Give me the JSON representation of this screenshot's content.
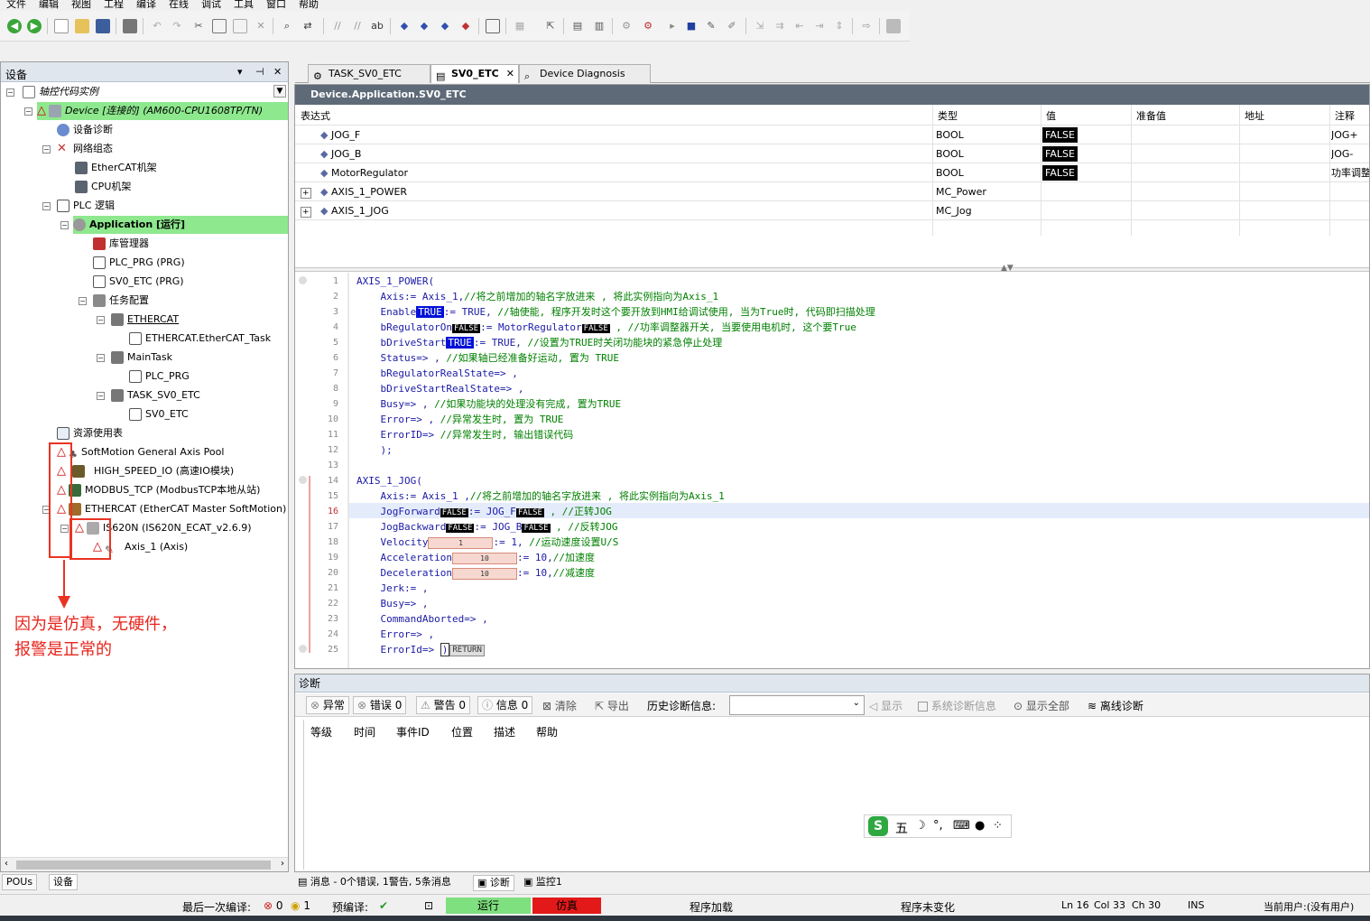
{
  "menu": [
    "文件",
    "编辑",
    "视图",
    "工程",
    "编译",
    "在线",
    "调试",
    "工具",
    "窗口",
    "帮助"
  ],
  "devices_panel": {
    "title": "设备",
    "pin": "⊣",
    "close": "✕",
    "tree": {
      "project": "轴控代码实例",
      "device": "Device [连接的] (AM600-CPU1608TP/TN)",
      "device_diag": "设备诊断",
      "network": "网络组态",
      "ethercat_rack": "EtherCAT机架",
      "cpu_rack": "CPU机架",
      "plc_logic": "PLC 逻辑",
      "application": "Application [运行]",
      "library": "库管理器",
      "plc_prg": "PLC_PRG (PRG)",
      "sv0_etc": "SV0_ETC (PRG)",
      "task_config": "任务配置",
      "ethercat_task": "ETHERCAT",
      "ethercat_task_child": "ETHERCAT.EtherCAT_Task",
      "main_task": "MainTask",
      "main_task_child": "PLC_PRG",
      "task_sv0": "TASK_SV0_ETC",
      "task_sv0_child": "SV0_ETC",
      "resources": "资源使用表",
      "axis_pool": "SoftMotion General Axis Pool",
      "high_speed_io": "HIGH_SPEED_IO (高速IO模块)",
      "modbus_tcp": "MODBUS_TCP (ModbusTCP本地从站)",
      "ethercat_master": "ETHERCAT (EtherCAT Master SoftMotion)",
      "is620n": "IS620N (IS620N_ECAT_v2.6.9)",
      "axis1": "Axis_1 (Axis)"
    },
    "bottom_tabs": [
      "POUs",
      "设备"
    ]
  },
  "annotation": {
    "note": "因为是仿真，无硬件，\n报警是正常的"
  },
  "editor": {
    "tabs": [
      "TASK_SV0_ETC",
      "SV0_ETC",
      "Device Diagnosis"
    ],
    "path": "Device.Application.SV0_ETC",
    "watch_columns": [
      "表达式",
      "类型",
      "值",
      "准备值",
      "地址",
      "注释"
    ],
    "watch_rows": [
      {
        "expr": "JOG_F",
        "type": "BOOL",
        "value": "FALSE",
        "comment": "JOG+"
      },
      {
        "expr": "JOG_B",
        "type": "BOOL",
        "value": "FALSE",
        "comment": "JOG-"
      },
      {
        "expr": "MotorRegulator",
        "type": "BOOL",
        "value": "FALSE",
        "comment": "功率调整"
      },
      {
        "expr": "AXIS_1_POWER",
        "type": "MC_Power",
        "value": "",
        "comment": ""
      },
      {
        "expr": "AXIS_1_JOG",
        "type": "MC_Jog",
        "value": "",
        "comment": ""
      }
    ],
    "code_lines": [
      "AXIS_1_POWER(",
      "    Axis:= Axis_1,//将之前增加的轴名字放进来 , 将此实例指向为Axis_1",
      "    Enable TRUE := TRUE, //轴使能, 程序开发时这个要开放到HMI给调试使用, 当为True时, 代码即扫描处理",
      "    bRegulatorOn FALSE := MotorRegulator FALSE , //功率调整器开关, 当要使用电机时, 这个要True",
      "    bDriveStart TRUE := TRUE, //设置为TRUE时关闭功能块的紧急停止处理",
      "    Status=> , //如果轴已经准备好运动, 置为 TRUE",
      "    bRegulatorRealState=> ,",
      "    bDriveStartRealState=> ,",
      "    Busy=> , //如果功能块的处理没有完成, 置为TRUE",
      "    Error=> , //异常发生时, 置为 TRUE",
      "    ErrorID=> //异常发生时, 输出错误代码",
      "    );",
      "",
      "AXIS_1_JOG(",
      "    Axis:= Axis_1 ,//将之前增加的轴名字放进来 , 将此实例指向为Axis_1",
      "    JogForward FALSE := JOG_F FALSE , //正转JOG",
      "    JogBackward FALSE := JOG_B FALSE , //反转JOG",
      "    Velocity 1 := 1, //运动速度设置U/S",
      "    Acceleration 10 := 10,//加速度",
      "    Deceleration 10 := 10,//减速度",
      "    Jerk:= ,",
      "    Busy=> ,",
      "    CommandAborted=> ,",
      "    Error=> ,",
      "    ErrorId=> ) RETURN"
    ],
    "code": {
      "c1": "AXIS_1_POWER(",
      "c2a": "Axis:= Axis_1,",
      "c2b": "//将之前增加的轴名字放进来 , 将此实例指向为Axis_1",
      "c3a": "Enable",
      "c3v": "TRUE",
      "c3b": ":= TRUE,",
      "c3c": " //轴使能, 程序开发时这个要开放到HMI给调试使用, 当为True时, 代码即扫描处理",
      "c4a": "bRegulatorOn",
      "c4v": "FALSE",
      "c4b": ":= MotorRegulator",
      "c4v2": "FALSE",
      "c4c": " , //功率调整器开关, 当要使用电机时, 这个要True",
      "c5a": "bDriveStart",
      "c5v": "TRUE",
      "c5b": ":= TRUE,",
      "c5c": " //设置为TRUE时关闭功能块的紧急停止处理",
      "c6a": "Status=> ,",
      "c6c": " //如果轴已经准备好运动, 置为 TRUE",
      "c7": "bRegulatorRealState=> ,",
      "c8": "bDriveStartRealState=> ,",
      "c9a": "Busy=> ,",
      "c9c": " //如果功能块的处理没有完成, 置为TRUE",
      "c10a": "Error=> ,",
      "c10c": " //异常发生时, 置为 TRUE",
      "c11a": "ErrorID=>",
      "c11c": " //异常发生时, 输出错误代码",
      "c12": ");",
      "c14": "AXIS_1_JOG(",
      "c15a": "Axis:= Axis_1 ,",
      "c15c": "//将之前增加的轴名字放进来 , 将此实例指向为Axis_1",
      "c16a": "JogForward",
      "c16v": "FALSE",
      "c16b": ":= JOG_F",
      "c16v2": "FALSE",
      "c16c": " , //正转JOG",
      "c17a": "JogBackward",
      "c17v": "FALSE",
      "c17b": ":= JOG_B",
      "c17v2": "FALSE",
      "c17c": " , //反转JOG",
      "c18a": "Velocity",
      "c18v": "1",
      "c18b": ":= 1,",
      "c18c": " //运动速度设置U/S",
      "c19a": "Acceleration",
      "c19v": "10",
      "c19b": ":= 10,",
      "c19c": "//加速度",
      "c20a": "Deceleration",
      "c20v": "10",
      "c20b": ":= 10,",
      "c20c": "//减速度",
      "c21": "Jerk:= ,",
      "c22": "Busy=> ,",
      "c23": "CommandAborted=> ,",
      "c24": "Error=> ,",
      "c25a": "ErrorId=>",
      "c25b": ")",
      "c25r": "RETURN"
    }
  },
  "diagnostics": {
    "title": "诊断",
    "buttons": [
      "异常",
      "错误 0",
      "警告 0",
      "信息 0",
      "清除",
      "导出"
    ],
    "history_label": "历史诊断信息:",
    "show": "显示",
    "sys_diag": "系统诊断信息",
    "show_all": "显示全部",
    "offline": "离线诊断",
    "columns": [
      "等级",
      "时间",
      "事件ID",
      "位置",
      "描述",
      "帮助"
    ]
  },
  "ime": {
    "text": "五"
  },
  "bottom_tabs": {
    "messages": "消息 - 0个错误, 1警告, 5条消息",
    "diag": "诊断",
    "monitor": "监控1"
  },
  "status": {
    "last_build": "最后一次编译:",
    "errors": "0",
    "warnings": "1",
    "precompile": "预编译:",
    "running": "运行",
    "sim": "仿真",
    "prog_load": "程序加载",
    "prog_unchanged": "程序未变化",
    "ln": "Ln 16",
    "col": "Col 33",
    "ch": "Ch 30",
    "ins": "INS",
    "user": "当前用户:(没有用户)"
  },
  "colors": {
    "running": "#7ee07e",
    "sim": "#e31919",
    "app_highlight": "#8ee88e",
    "annotation": "#ea3323"
  }
}
